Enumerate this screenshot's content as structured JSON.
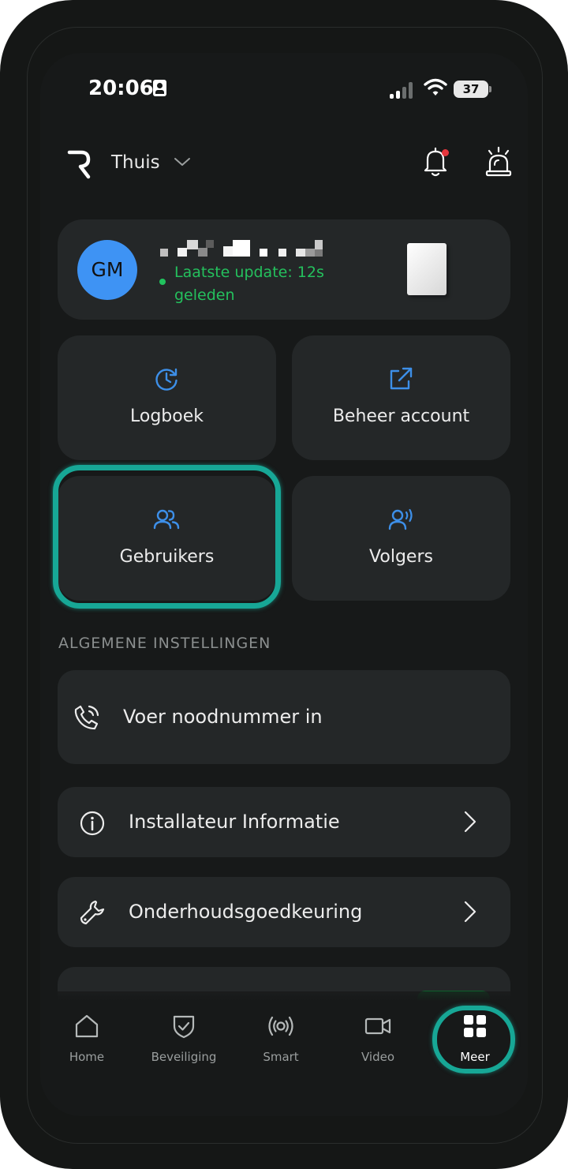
{
  "status_bar": {
    "time": "20:06",
    "battery": "37"
  },
  "header": {
    "home_name": "Thuis"
  },
  "profile": {
    "initials": "GM",
    "update_text": "Laatste update: 12s geleden"
  },
  "tiles": [
    {
      "label": "Logboek",
      "icon": "history-clock-icon"
    },
    {
      "label": "Beheer account",
      "icon": "external-link-icon"
    },
    {
      "label": "Gebruikers",
      "icon": "users-icon"
    },
    {
      "label": "Volgers",
      "icon": "follower-broadcast-icon"
    }
  ],
  "section": {
    "title": "ALGEMENE INSTELLINGEN"
  },
  "settings": [
    {
      "label": "Voer noodnummer in",
      "icon": "phone-call-icon"
    },
    {
      "label": "Installateur Informatie",
      "icon": "info-icon"
    },
    {
      "label": "Onderhoudsgoedkeuring",
      "icon": "wrench-icon"
    }
  ],
  "tabs": [
    {
      "label": "Home",
      "icon": "home-icon"
    },
    {
      "label": "Beveiliging",
      "icon": "shield-check-icon"
    },
    {
      "label": "Smart",
      "icon": "broadcast-icon"
    },
    {
      "label": "Video",
      "icon": "video-camera-icon"
    },
    {
      "label": "Meer",
      "icon": "grid-icon"
    }
  ],
  "colors": {
    "accent": "#17a796",
    "status_green": "#24c05d",
    "avatar_blue": "#3e93f4",
    "icon_blue": "#3d8fe8",
    "alert_red": "#e5363d"
  }
}
